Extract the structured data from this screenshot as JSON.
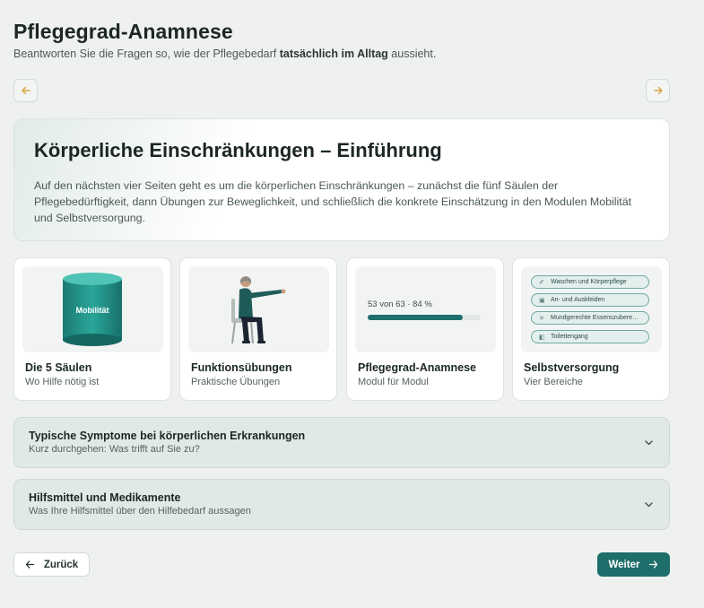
{
  "header": {
    "title": "Pflegegrad-Anamnese",
    "subtitle_pre": "Beantworten Sie die Fragen so, wie der Pflegebedarf ",
    "subtitle_bold": "tatsächlich im Alltag",
    "subtitle_post": " aussieht."
  },
  "nav": {
    "prev_icon": "arrow-left-icon",
    "next_icon": "arrow-right-icon",
    "accent_color": "#d9a441"
  },
  "intro": {
    "title": "Körperliche Einschränkungen – Einführung",
    "text": "Auf den nächsten vier Seiten geht es um die körperlichen Einschränkungen – zunächst die fünf Säulen der Pflegebedürftigkeit, dann Übungen zur Beweglichkeit, und schließlich die konkrete Einschätzung in den Modulen Mobilität und Selbstversorgung."
  },
  "tiles": [
    {
      "title": "Die 5 Säulen",
      "subtitle": "Wo Hilfe nötig ist",
      "media_label": "Mobilität"
    },
    {
      "title": "Funktionsübungen",
      "subtitle": "Praktische Übungen"
    },
    {
      "title": "Pflegegrad-Anamnese",
      "subtitle": "Modul für Modul",
      "progress_text": "53 von 63 · 84 %",
      "progress_value": 0.84
    },
    {
      "title": "Selbstversorgung",
      "subtitle": "Vier Bereiche",
      "pills": [
        {
          "icon": "wash-icon",
          "label": "Waschen und Körperpflege"
        },
        {
          "icon": "shirt-icon",
          "label": "An- und Auskleiden"
        },
        {
          "icon": "cutlery-icon",
          "label": "Mundgerechte Essenszubere…"
        },
        {
          "icon": "toilet-icon",
          "label": "Toilettengang"
        }
      ]
    }
  ],
  "accordions": [
    {
      "title": "Typische Symptome bei körperlichen Erkrankungen",
      "subtitle": "Kurz durchgehen: Was trifft auf Sie zu?"
    },
    {
      "title": "Hilfsmittel und Medikamente",
      "subtitle": "Was Ihre Hilfsmittel über den Hilfebedarf aussagen"
    }
  ],
  "footer": {
    "back_label": "Zurück",
    "next_label": "Weiter"
  },
  "colors": {
    "primary": "#1e6e6b",
    "background": "#eef1ef"
  }
}
